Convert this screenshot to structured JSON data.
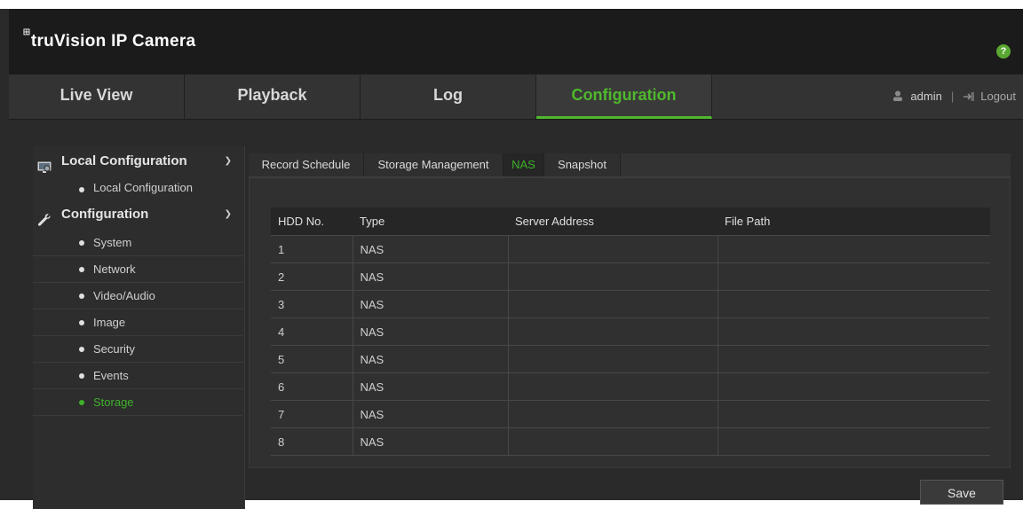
{
  "header": {
    "app_title": "truVision IP Camera",
    "logo_mark": "⊞",
    "help_label": "?"
  },
  "nav": {
    "tabs": [
      {
        "label": "Live View",
        "active": false
      },
      {
        "label": "Playback",
        "active": false
      },
      {
        "label": "Log",
        "active": false
      },
      {
        "label": "Configuration",
        "active": true
      }
    ],
    "user": "admin",
    "separator": "|",
    "logout": "Logout"
  },
  "sidebar": {
    "groups": [
      {
        "label": "Local Configuration",
        "icon": "monitor-gear-icon",
        "expanded": true,
        "items": [
          {
            "label": "Local Configuration"
          }
        ]
      },
      {
        "label": "Configuration",
        "icon": "wrench-icon",
        "expanded": true,
        "items": [
          {
            "label": "System"
          },
          {
            "label": "Network"
          },
          {
            "label": "Video/Audio"
          },
          {
            "label": "Image"
          },
          {
            "label": "Security"
          },
          {
            "label": "Events"
          },
          {
            "label": "Storage",
            "active": true
          }
        ]
      }
    ]
  },
  "subtabs": [
    {
      "label": "Record Schedule"
    },
    {
      "label": "Storage Management"
    },
    {
      "label": "NAS",
      "active": true
    },
    {
      "label": "Snapshot"
    }
  ],
  "table": {
    "headers": [
      "HDD No.",
      "Type",
      "Server Address",
      "File Path"
    ],
    "rows": [
      [
        "1",
        "NAS",
        "",
        ""
      ],
      [
        "2",
        "NAS",
        "",
        ""
      ],
      [
        "3",
        "NAS",
        "",
        ""
      ],
      [
        "4",
        "NAS",
        "",
        ""
      ],
      [
        "5",
        "NAS",
        "",
        ""
      ],
      [
        "6",
        "NAS",
        "",
        ""
      ],
      [
        "7",
        "NAS",
        "",
        ""
      ],
      [
        "8",
        "NAS",
        "",
        ""
      ]
    ]
  },
  "save_label": "Save",
  "colors": {
    "accent_green": "#4fb82c",
    "header_bg": "#1b1b1b",
    "body_bg": "#2a2a2a"
  }
}
